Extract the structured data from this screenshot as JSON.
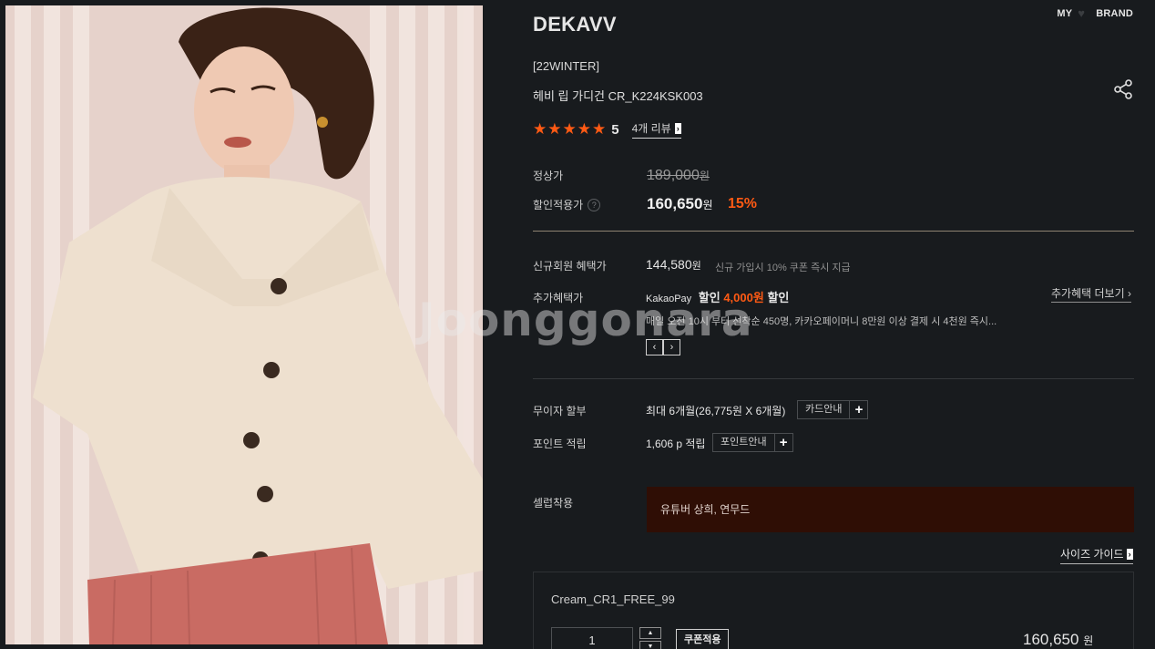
{
  "topnav": {
    "my": "MY",
    "brand": "BRAND"
  },
  "product": {
    "brand": "DEKAVV",
    "season": "[22WINTER]",
    "name": "헤비 립 가디건 CR_K224KSK003",
    "rating": 5,
    "rating_text": "5",
    "stars": 5,
    "review_link": "4개 리뷰"
  },
  "price": {
    "regular_label": "정상가",
    "regular_value": "189,000",
    "won": "원",
    "sale_label": "할인적용가",
    "sale_value": "160,650",
    "discount": "15%"
  },
  "benefits": {
    "new_member_label": "신규회원 혜택가",
    "new_member_value": "144,580",
    "new_member_note": "신규 가입시 10% 쿠폰 즉시 지급",
    "extra_label": "추가혜택가",
    "kakao_pay": "KakaoPay",
    "kakao_prefix": "할인",
    "kakao_amount": "4,000원",
    "kakao_suffix": "할인",
    "more_link": "추가혜택 더보기",
    "extra_desc": "매일 오전 10시 부터 선착순 450명, 카카오페이머니 8만원 이상 결제 시 4천원 즉시..."
  },
  "installment": {
    "label": "무이자 할부",
    "value": "최대 6개월(26,775원 X 6개월)",
    "button": "카드안내"
  },
  "point": {
    "label": "포인트 적립",
    "value": "1,606 p 적립",
    "button": "포인트안내"
  },
  "celeb": {
    "label": "셀럽착용",
    "value": "유튜버 상희, 연무드"
  },
  "size_guide": "사이즈 가이드",
  "option": {
    "name": "Cream_CR1_FREE_99",
    "quantity": "1",
    "coupon_button": "쿠폰적용",
    "price": "160,650",
    "won": "원"
  },
  "watermark": "Joonggonara",
  "colors": {
    "background": "#181b1e",
    "accent": "#ff5a14",
    "celeb_box": "#2f0e05"
  },
  "icons": {
    "share": "share-icon",
    "heart": "heart-icon",
    "star": "star-icon",
    "help": "question-icon"
  }
}
